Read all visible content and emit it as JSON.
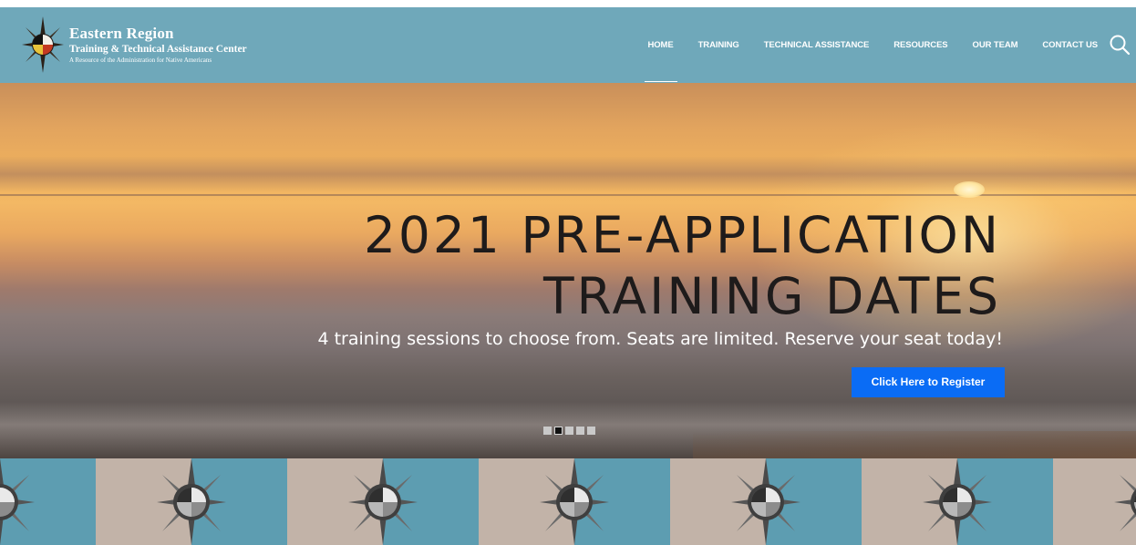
{
  "header": {
    "logo": {
      "title": "Eastern Region",
      "subtitle": "Training & Technical Assistance Center",
      "tagline": "A Resource of the Administration for Native Americans",
      "icon": "medicine-wheel-icon"
    },
    "nav": [
      {
        "label": "HOME",
        "active": true
      },
      {
        "label": "TRAINING",
        "active": false
      },
      {
        "label": "TECHNICAL ASSISTANCE",
        "active": false
      },
      {
        "label": "RESOURCES",
        "active": false
      },
      {
        "label": "OUR TEAM",
        "active": false
      },
      {
        "label": "CONTACT US",
        "active": false
      }
    ],
    "search_icon": "search-icon",
    "background_color": "#6fa8ba"
  },
  "hero": {
    "title_line1": "2021 PRE-APPLICATION",
    "title_line2": "TRAINING DATES",
    "subtitle": "4 training sessions to choose from. Seats are limited. Reserve your seat today!",
    "cta_label": "Click Here to Register",
    "cta_color": "#0a6cf5",
    "slides_count": 5,
    "active_slide": 2
  },
  "band": {
    "colors": [
      "#5d9db1",
      "#c2b3a8"
    ],
    "icon": "medicine-wheel-icon"
  }
}
